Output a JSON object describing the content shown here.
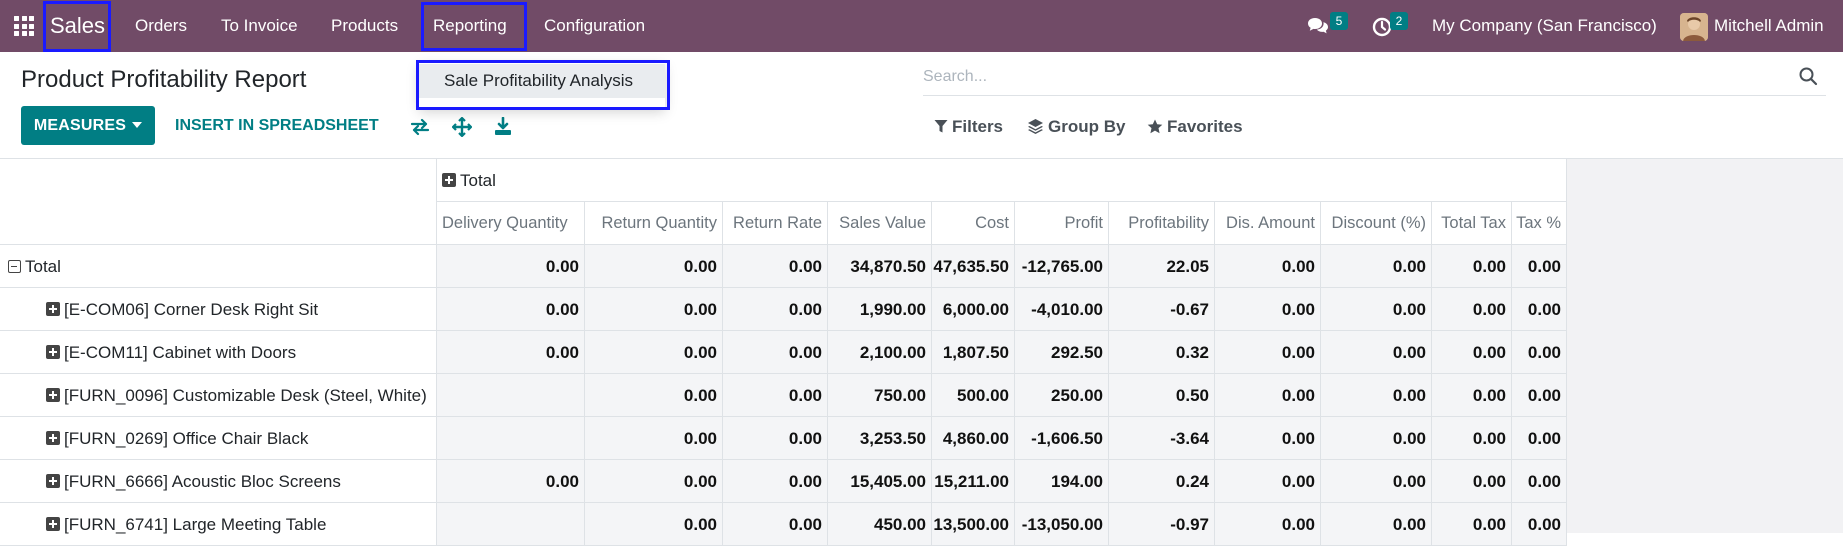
{
  "navbar": {
    "brand": "Sales",
    "menu": [
      "Orders",
      "To Invoice",
      "Products",
      "Reporting",
      "Configuration"
    ],
    "messages_count": "5",
    "activities_count": "2",
    "company": "My Company (San Francisco)",
    "user": "Mitchell Admin"
  },
  "dropdown": {
    "item": "Sale Profitability Analysis"
  },
  "control": {
    "title": "Product Profitability Report",
    "measures_label": "MEASURES",
    "insert_label": "INSERT IN SPREADSHEET",
    "search_placeholder": "Search...",
    "filters_label": "Filters",
    "groupby_label": "Group By",
    "favorites_label": "Favorites"
  },
  "pivot": {
    "col_group": "Total",
    "columns": [
      "Delivery Quantity",
      "Return Quantity",
      "Return Rate",
      "Sales Value",
      "Cost",
      "Profit",
      "Profitability",
      "Dis. Amount",
      "Discount (%)",
      "Total Tax",
      "Tax %"
    ],
    "rows": [
      {
        "label": "Total",
        "values": [
          "0.00",
          "0.00",
          "0.00",
          "34,870.50",
          "47,635.50",
          "-12,765.00",
          "22.05",
          "0.00",
          "0.00",
          "0.00",
          "0.00"
        ]
      },
      {
        "label": "[E-COM06] Corner Desk Right Sit",
        "values": [
          "0.00",
          "0.00",
          "0.00",
          "1,990.00",
          "6,000.00",
          "-4,010.00",
          "-0.67",
          "0.00",
          "0.00",
          "0.00",
          "0.00"
        ]
      },
      {
        "label": "[E-COM11] Cabinet with Doors",
        "values": [
          "0.00",
          "0.00",
          "0.00",
          "2,100.00",
          "1,807.50",
          "292.50",
          "0.32",
          "0.00",
          "0.00",
          "0.00",
          "0.00"
        ]
      },
      {
        "label": "[FURN_0096] Customizable Desk (Steel, White)",
        "values": [
          "",
          "0.00",
          "0.00",
          "750.00",
          "500.00",
          "250.00",
          "0.50",
          "0.00",
          "0.00",
          "0.00",
          "0.00"
        ]
      },
      {
        "label": "[FURN_0269] Office Chair Black",
        "values": [
          "",
          "0.00",
          "0.00",
          "3,253.50",
          "4,860.00",
          "-1,606.50",
          "-3.64",
          "0.00",
          "0.00",
          "0.00",
          "0.00"
        ]
      },
      {
        "label": "[FURN_6666] Acoustic Bloc Screens",
        "values": [
          "0.00",
          "0.00",
          "0.00",
          "15,405.00",
          "15,211.00",
          "194.00",
          "0.24",
          "0.00",
          "0.00",
          "0.00",
          "0.00"
        ]
      },
      {
        "label": "[FURN_6741] Large Meeting Table",
        "values": [
          "",
          "0.00",
          "0.00",
          "450.00",
          "13,500.00",
          "-13,050.00",
          "-0.97",
          "0.00",
          "0.00",
          "0.00",
          "0.00"
        ]
      }
    ]
  }
}
